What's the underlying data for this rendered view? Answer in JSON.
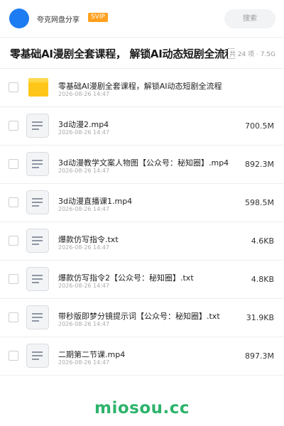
{
  "header": {
    "share_title": "夸克网盘分享",
    "badge": "SVIP",
    "search_label": "搜索"
  },
  "title": {
    "text": "零基础AI漫剧全套课程， 解锁AI动态短剧全流程",
    "meta": "共 24 项 · 7.5G"
  },
  "files": [
    {
      "name": "零基础AI漫剧全套课程，解锁AI动态短剧全流程",
      "date": "2026-08-26 14:47",
      "size": "",
      "type": "folder-icon"
    },
    {
      "name": "3d动漫2.mp4",
      "date": "2026-08-26 14:47",
      "size": "700.5M",
      "type": "file-icon"
    },
    {
      "name": "3d动漫教学文案人物图【公众号：秘知圈】.mp4",
      "date": "2026-08-26 14:47",
      "size": "892.3M",
      "type": "file-icon"
    },
    {
      "name": "3d动漫直播课1.mp4",
      "date": "2026-08-26 14:47",
      "size": "598.5M",
      "type": "file-icon"
    },
    {
      "name": "爆款仿写指令.txt",
      "date": "2026-08-26 14:47",
      "size": "4.6KB",
      "type": "file-icon"
    },
    {
      "name": "爆款仿写指令2【公众号：秘知圈】.txt",
      "date": "2026-08-26 14:47",
      "size": "4.8KB",
      "type": "file-icon"
    },
    {
      "name": "带秒版即梦分镜提示词【公众号：秘知圈】.txt",
      "date": "2026-08-26 14:47",
      "size": "31.9KB",
      "type": "file-icon"
    },
    {
      "name": "二期第二节课.mp4",
      "date": "2026-08-26 14:47",
      "size": "897.3M",
      "type": "file-icon"
    }
  ],
  "watermark": "miosou.cc",
  "colors": {
    "accent": "#1e7cf2",
    "badge": "#ffa01e",
    "folder": "#ffc61a",
    "watermark": "#2db36b"
  }
}
